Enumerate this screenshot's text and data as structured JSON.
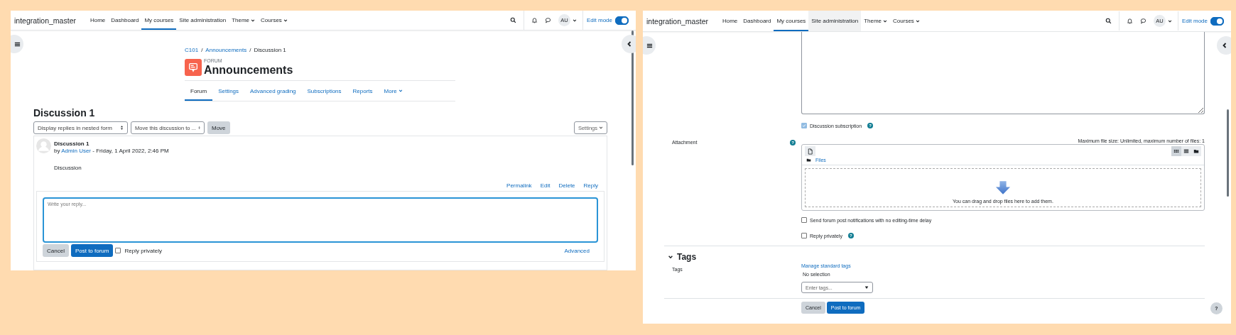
{
  "left_screen": {
    "navbar": {
      "site_name": "integration_master",
      "items": [
        {
          "label": "Home",
          "selected": false,
          "highlighted": false,
          "dropdown": false
        },
        {
          "label": "Dashboard",
          "selected": false,
          "highlighted": false,
          "dropdown": false
        },
        {
          "label": "My courses",
          "selected": true,
          "highlighted": false,
          "dropdown": false
        },
        {
          "label": "Site administration",
          "selected": false,
          "highlighted": false,
          "dropdown": false
        },
        {
          "label": "Theme",
          "selected": false,
          "highlighted": false,
          "dropdown": true
        },
        {
          "label": "Courses",
          "selected": false,
          "highlighted": false,
          "dropdown": true
        }
      ],
      "avatar": "AU",
      "edit_mode": {
        "label": "Edit mode",
        "on": true
      }
    },
    "breadcrumb": [
      "C101",
      "Announcements",
      "Discussion 1"
    ],
    "breadcrumb_separator": "/",
    "activity": {
      "type_label": "FORUM",
      "title": "Announcements"
    },
    "tabs": [
      {
        "label": "Forum",
        "selected": true,
        "dropdown": false
      },
      {
        "label": "Settings",
        "selected": false,
        "dropdown": false
      },
      {
        "label": "Advanced grading",
        "selected": false,
        "dropdown": false
      },
      {
        "label": "Subscriptions",
        "selected": false,
        "dropdown": false
      },
      {
        "label": "Reports",
        "selected": false,
        "dropdown": false
      },
      {
        "label": "More",
        "selected": false,
        "dropdown": true
      }
    ],
    "heading": "Discussion 1",
    "display_select": "Display replies in nested form",
    "move_select": "Move this discussion to ...",
    "move_button": "Move",
    "settings_button": "Settings",
    "post": {
      "subject": "Discussion 1",
      "by": "by",
      "author": "Admin User",
      "date": "- Friday, 1 April 2022, 2:46 PM",
      "body": "Discussion",
      "actions": [
        "Permalink",
        "Edit",
        "Delete",
        "Reply"
      ]
    },
    "reply_form": {
      "placeholder": "Write your reply...",
      "cancel": "Cancel",
      "submit": "Post to forum",
      "private": {
        "label": "Reply privately",
        "checked": false
      },
      "advanced": "Advanced"
    }
  },
  "right_screen": {
    "navbar": {
      "site_name": "integration_master",
      "items": [
        {
          "label": "Home",
          "selected": false,
          "highlighted": false,
          "dropdown": false
        },
        {
          "label": "Dashboard",
          "selected": false,
          "highlighted": false,
          "dropdown": false
        },
        {
          "label": "My courses",
          "selected": true,
          "highlighted": false,
          "dropdown": false
        },
        {
          "label": "Site administration",
          "selected": false,
          "highlighted": true,
          "dropdown": false
        },
        {
          "label": "Theme",
          "selected": false,
          "highlighted": false,
          "dropdown": true
        },
        {
          "label": "Courses",
          "selected": false,
          "highlighted": false,
          "dropdown": true
        }
      ],
      "avatar": "AU",
      "edit_mode": {
        "label": "Edit mode",
        "on": true
      }
    },
    "subscription": {
      "label": "Discussion subscription",
      "checked": true,
      "disabled": true,
      "help": "?"
    },
    "attachment": {
      "label": "Attachment",
      "help": "?",
      "limits": "Maximum file size: Unlimited, maximum number of files: 1",
      "path": "Files",
      "drop_hint": "You can drag and drop files here to add them.",
      "views": [
        {
          "kind": "icons",
          "selected": true
        },
        {
          "kind": "list",
          "selected": false
        },
        {
          "kind": "tree",
          "selected": false
        }
      ]
    },
    "notify_no_delay": {
      "label": "Send forum post notifications with no editing-time delay",
      "checked": false
    },
    "reply_privately": {
      "label": "Reply privately",
      "checked": false,
      "help": "?"
    },
    "tags_section": {
      "title": "Tags",
      "expanded": true,
      "label": "Tags",
      "manage_link": "Manage standard tags",
      "selection": "No selection",
      "placeholder": "Enter tags..."
    },
    "buttons": [
      {
        "kind": "secondary",
        "label": "Cancel"
      },
      {
        "kind": "primary",
        "label": "Post to forum"
      }
    ],
    "help_button": "?"
  }
}
